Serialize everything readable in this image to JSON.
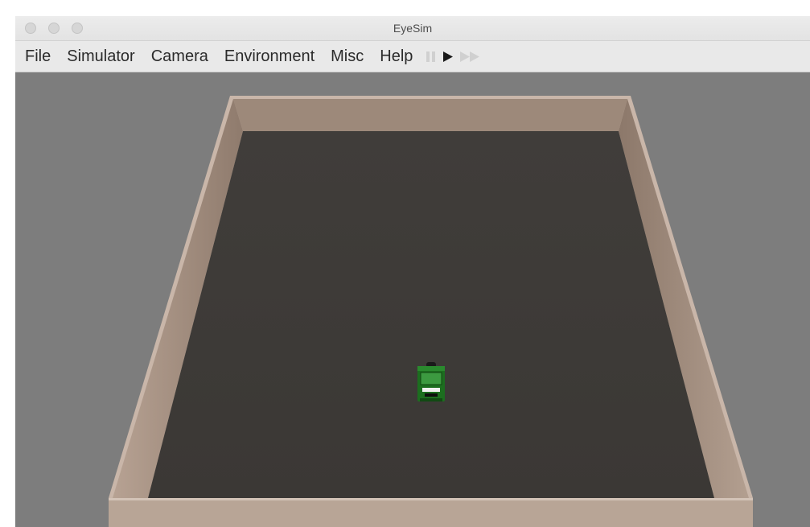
{
  "window": {
    "title": "EyeSim"
  },
  "menu": {
    "items": [
      "File",
      "Simulator",
      "Camera",
      "Environment",
      "Misc",
      "Help"
    ]
  },
  "controls": {
    "pause_icon": "pause-icon",
    "play_icon": "play-icon",
    "fast_forward_icon": "fast-forward-icon"
  },
  "colors": {
    "floor": "#3e3b38",
    "wall_top": "#c8b5a8",
    "wall_inner": "#a89484",
    "robot": "#1e7a22",
    "background": "#7d7d7d"
  }
}
